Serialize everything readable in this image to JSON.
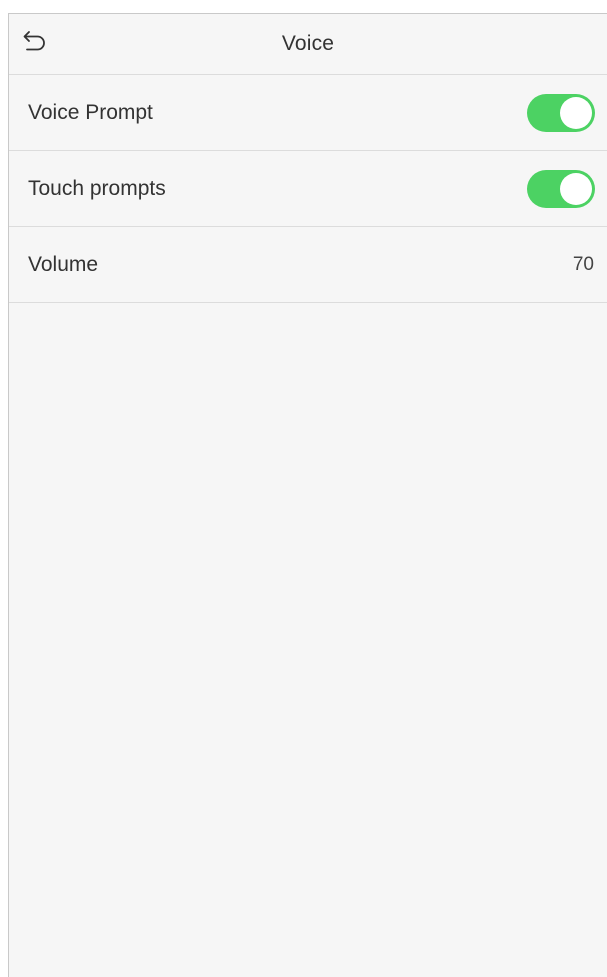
{
  "header": {
    "title": "Voice",
    "back_icon": "back-arrow-icon"
  },
  "settings": [
    {
      "label": "Voice Prompt",
      "type": "toggle",
      "on": true
    },
    {
      "label": "Touch prompts",
      "type": "toggle",
      "on": true
    },
    {
      "label": "Volume",
      "type": "value",
      "value": "70"
    }
  ],
  "colors": {
    "toggle_on": "#4cd263",
    "background": "#f6f6f6",
    "divider": "#dcdcdc",
    "text": "#333333"
  }
}
